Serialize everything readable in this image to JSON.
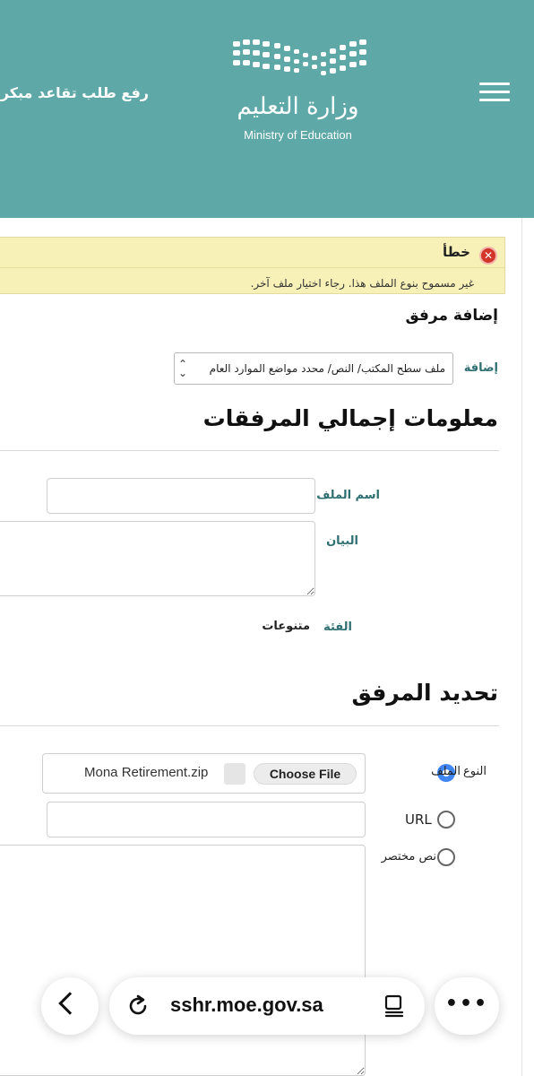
{
  "header": {
    "link": "رفع طلب تقاعد مبكر",
    "logo_ar": "وزارة التعليم",
    "logo_en": "Ministry of Education",
    "bg_color": "#5ea8a8"
  },
  "error": {
    "title": "خطأ",
    "message": "غير مسموح بنوع الملف هذا. رجاء اختيار ملف آخر.",
    "bg_color": "#f7f1b8"
  },
  "add_attachment": {
    "heading": "إضافة مرفق",
    "label": "إضافة",
    "selected_option": "ملف سطح المكتب/ النص/ محدد مواضع الموارد العام"
  },
  "summary": {
    "heading": "معلومات إجمالي المرفقات",
    "filename_label": "اسم الملف",
    "filename_value": "",
    "description_label": "البيان",
    "description_value": "",
    "category_label": "الفئة",
    "category_value": "متنوعات"
  },
  "target": {
    "heading": "تحديد المرفق",
    "type_label": "النوع",
    "option_file": "الملف",
    "option_url": "URL",
    "option_text": "نص مختصر",
    "choose_file_label": "Choose File",
    "chosen_file": "Mona Retirement.zip",
    "url_value": "",
    "text_value": ""
  },
  "browser": {
    "url": "sshr.moe.gov.sa",
    "more": "•••"
  }
}
